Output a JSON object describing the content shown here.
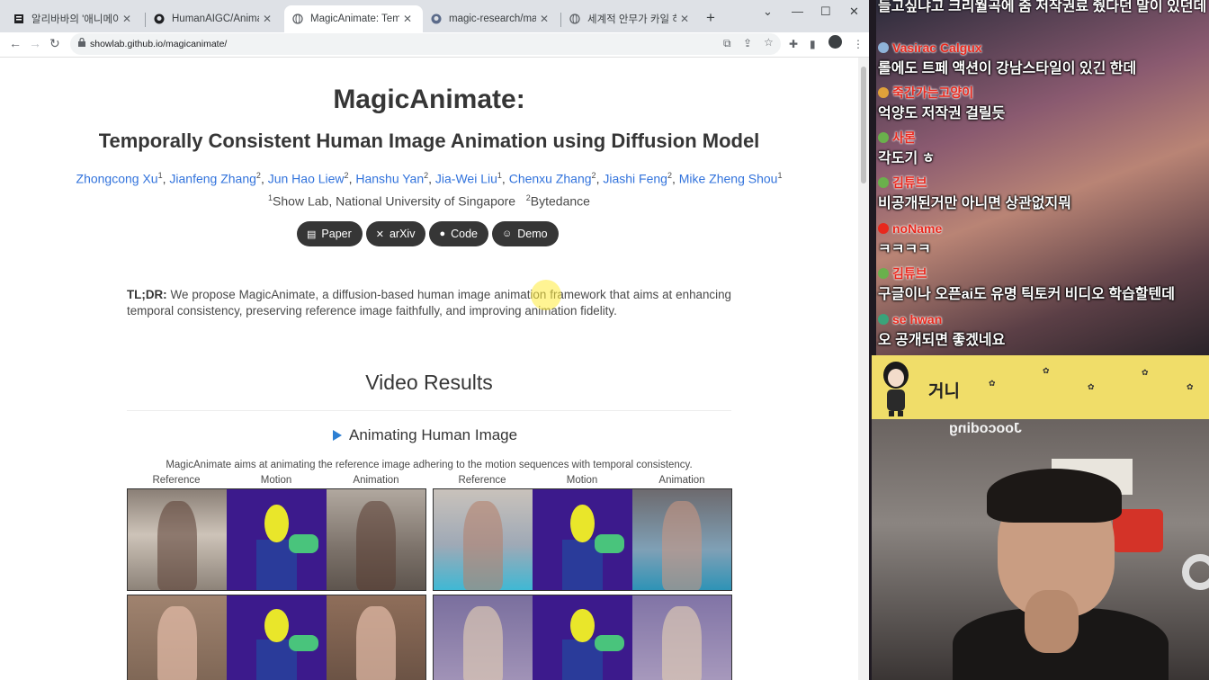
{
  "browser": {
    "tabs": [
      {
        "title": "알리바바의 '애니메이트 누구",
        "icon": "document-icon",
        "active": false
      },
      {
        "title": "HumanAIGC/AnimateAnyone",
        "icon": "github-icon",
        "active": false
      },
      {
        "title": "MagicAnimate: Temporally C",
        "icon": "globe-icon",
        "active": true
      },
      {
        "title": "magic-research/magic-anim",
        "icon": "github-icon",
        "active": false
      },
      {
        "title": "세계적 안무가 카일 하나가이",
        "icon": "globe-icon",
        "active": false
      }
    ],
    "url": "showlab.github.io/magicanimate/"
  },
  "page": {
    "title": "MagicAnimate:",
    "subtitle": "Temporally Consistent Human Image Animation using Diffusion Model",
    "authors": [
      {
        "name": "Zhongcong Xu",
        "aff": "1"
      },
      {
        "name": "Jianfeng Zhang",
        "aff": "2"
      },
      {
        "name": "Jun Hao Liew",
        "aff": "2"
      },
      {
        "name": "Hanshu Yan",
        "aff": "2"
      },
      {
        "name": "Jia-Wei Liu",
        "aff": "1"
      },
      {
        "name": "Chenxu Zhang",
        "aff": "2"
      },
      {
        "name": "Jiashi Feng",
        "aff": "2"
      },
      {
        "name": "Mike Zheng Shou",
        "aff": "1"
      }
    ],
    "affiliations": [
      {
        "sup": "1",
        "name": "Show Lab, National University of Singapore"
      },
      {
        "sup": "2",
        "name": "Bytedance"
      }
    ],
    "links": [
      {
        "label": "Paper",
        "icon": "pdf-icon"
      },
      {
        "label": "arXiv",
        "icon": "x-icon"
      },
      {
        "label": "Code",
        "icon": "github-icon"
      },
      {
        "label": "Demo",
        "icon": "huggingface-icon"
      }
    ],
    "tldr_label": "TL;DR:",
    "tldr_text": " We propose MagicAnimate, a diffusion-based human image animation framework that aims at enhancing temporal consistency, preserving reference image faithfully, and improving animation fidelity.",
    "video_results_title": "Video Results",
    "animating_title": "Animating Human Image",
    "animating_desc": "MagicAnimate aims at animating the reference image adhering to the motion sequences with temporal consistency.",
    "column_headers": [
      "Reference",
      "Motion",
      "Animation",
      "Reference",
      "Motion",
      "Animation"
    ]
  },
  "stream": {
    "chat_top": "들고싶냐고 크리월곡에 줌 저작권료 줬다던 말이 있던데",
    "messages": [
      {
        "user": "Vasirac Calgux",
        "text": "롤에도 트페 액션이 강남스타일이 있긴 한데",
        "badge_color": "#8fb3d9"
      },
      {
        "user": "죽간가는고양이",
        "text": "억양도 저작권 걸릴듯",
        "badge_color": "#e0a13a"
      },
      {
        "user": "사론",
        "text": "각도기 ㅎ",
        "badge_color": "#6ab04c"
      },
      {
        "user": "김튜브",
        "text": "비공개된거만 아니면 상관없지뭐",
        "badge_color": "#6ab04c"
      },
      {
        "user": "noName",
        "text": "ㅋㅋㅋㅋ",
        "badge_color": "#e8281d"
      },
      {
        "user": "김튜브",
        "text": "구글이나 오픈ai도 유명 틱토커 비디오 학습할텐데",
        "badge_color": "#6ab04c"
      },
      {
        "user": "se hwan",
        "text": "오 공개되면 좋겠네요",
        "badge_color": "#3aa37a"
      }
    ],
    "banner_text": "거니",
    "cam_sign": "Joocoding"
  }
}
